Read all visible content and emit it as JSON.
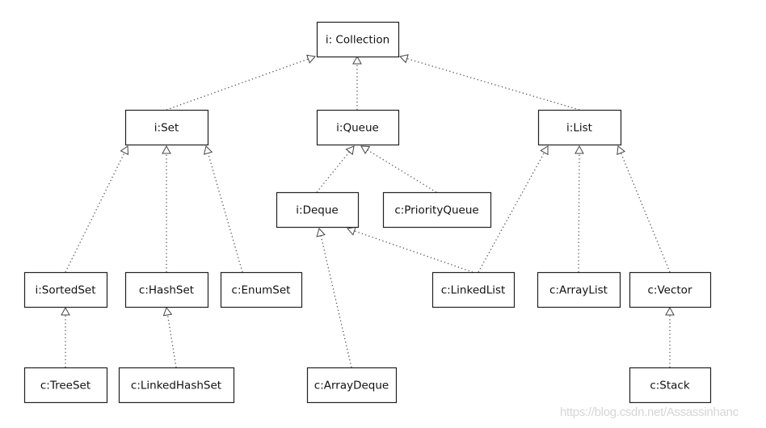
{
  "nodes": {
    "collection": "i: Collection",
    "set": "i:Set",
    "queue": "i:Queue",
    "list": "i:List",
    "deque": "i:Deque",
    "priorityqueue": "c:PriorityQueue",
    "sortedset": "i:SortedSet",
    "hashset": "c:HashSet",
    "enumset": "c:EnumSet",
    "linkedlist": "c:LinkedList",
    "arraylist": "c:ArrayList",
    "vector": "c:Vector",
    "treeset": "c:TreeSet",
    "linkedhashset": "c:LinkedHashSet",
    "arraydeque": "c:ArrayDeque",
    "stack": "c:Stack"
  },
  "edges": [
    {
      "from": "set",
      "to": "collection"
    },
    {
      "from": "queue",
      "to": "collection"
    },
    {
      "from": "list",
      "to": "collection"
    },
    {
      "from": "deque",
      "to": "queue"
    },
    {
      "from": "priorityqueue",
      "to": "queue"
    },
    {
      "from": "sortedset",
      "to": "set"
    },
    {
      "from": "hashset",
      "to": "set"
    },
    {
      "from": "enumset",
      "to": "set"
    },
    {
      "from": "arraydeque",
      "to": "deque"
    },
    {
      "from": "linkedlist",
      "to": "deque"
    },
    {
      "from": "linkedlist",
      "to": "list"
    },
    {
      "from": "arraylist",
      "to": "list"
    },
    {
      "from": "vector",
      "to": "list"
    },
    {
      "from": "treeset",
      "to": "sortedset"
    },
    {
      "from": "linkedhashset",
      "to": "hashset"
    },
    {
      "from": "stack",
      "to": "vector"
    }
  ],
  "edge_style": {
    "line": "dotted",
    "arrowhead": "hollow-triangle",
    "color": "#555555"
  },
  "watermark": "https://blog.csdn.net/Assassinhanc"
}
